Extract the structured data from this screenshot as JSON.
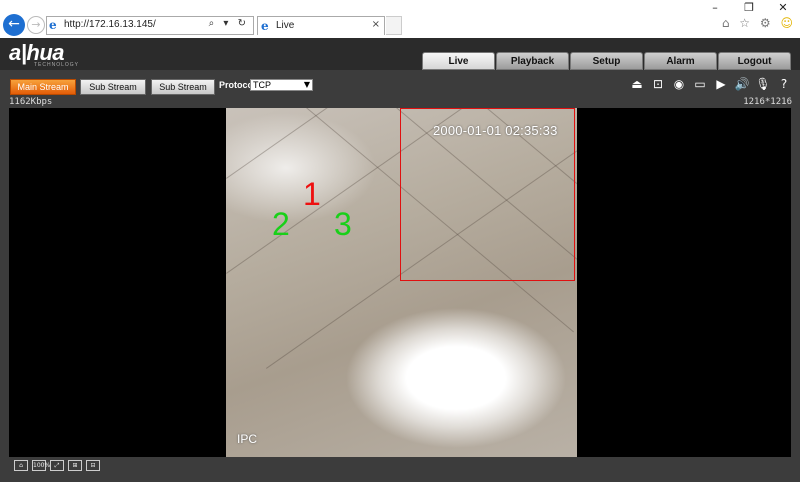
{
  "browser": {
    "window_controls": [
      "–",
      "❐",
      "✕"
    ],
    "back_icon": "←",
    "forward_icon": "→",
    "address_url": "http://172.16.13.145/",
    "address_tools": "⌕ ▾ ↻",
    "tab_title": "Live",
    "tab_close": "×",
    "right_icons": [
      "⌂",
      "☆",
      "⚙"
    ],
    "smiley_icon": "☺"
  },
  "header": {
    "logo": "a|hua",
    "logo_sub": "TECHNOLOGY",
    "tabs": [
      {
        "label": "Live"
      },
      {
        "label": "Playback"
      },
      {
        "label": "Setup"
      },
      {
        "label": "Alarm"
      },
      {
        "label": "Logout"
      }
    ],
    "active_tab": "Live"
  },
  "toolbar": {
    "main_stream": "Main Stream",
    "sub_stream_1": "Sub Stream 1",
    "sub_stream_2": "Sub Stream 2",
    "protocol_label": "Protocol",
    "protocol_value": "TCP",
    "icons": [
      "⏏",
      "⊡",
      "◉",
      "▭",
      "▶",
      "🔊",
      "🎙",
      "?"
    ]
  },
  "info": {
    "bitrate": "1162Kbps",
    "resolution": "1216*1216"
  },
  "video": {
    "timestamp": "2000-01-01 02:35:33",
    "channel_label": "IPC",
    "markers": [
      "1",
      "2",
      "3"
    ]
  },
  "bottom": {
    "icons": [
      "⌂",
      "100%",
      "⤢",
      "⊞",
      "⊟"
    ]
  },
  "colors": {
    "accent_orange": "#e35d08",
    "motion_box": "#e01010",
    "marker_red": "#ee1010",
    "marker_green": "#19d019"
  }
}
